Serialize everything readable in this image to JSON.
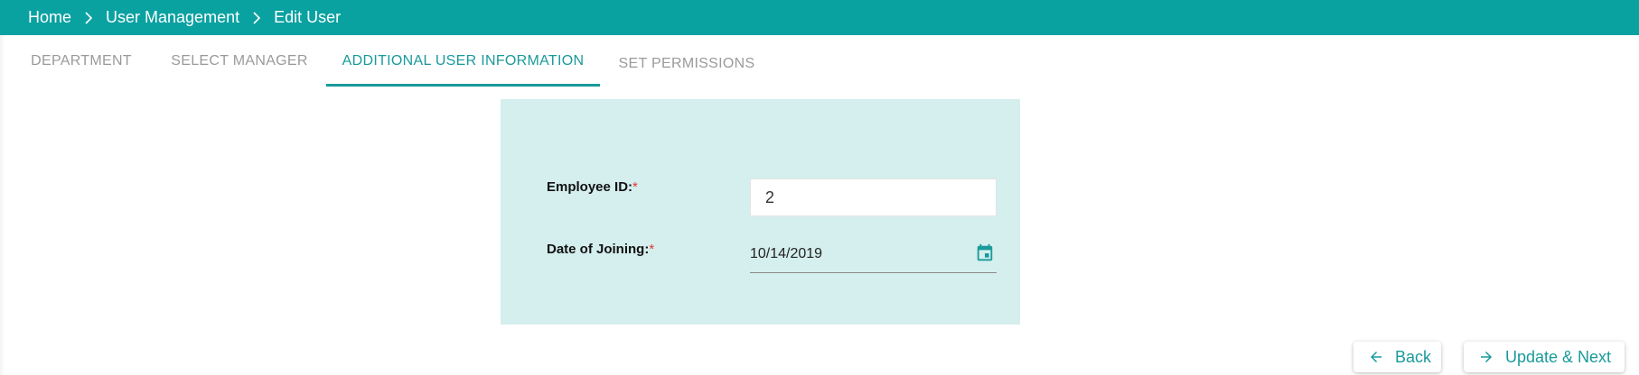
{
  "breadcrumb": {
    "items": [
      "Home",
      "User Management"
    ],
    "current": "Edit User"
  },
  "tabs": [
    {
      "label": "DEPARTMENT",
      "active": false
    },
    {
      "label": "SELECT MANAGER",
      "active": false
    },
    {
      "label": "ADDITIONAL USER INFORMATION",
      "active": true
    },
    {
      "label": "SET PERMISSIONS",
      "active": false
    }
  ],
  "form": {
    "employee_id": {
      "label": "Employee ID:",
      "required_mark": "*",
      "value": "2"
    },
    "date_of_joining": {
      "label": "Date of Joining:",
      "required_mark": "*",
      "value": "10/14/2019"
    }
  },
  "actions": {
    "back_label": "Back",
    "next_label": "Update & Next"
  },
  "colors": {
    "accent": "#0aa1a1",
    "panel_bg": "#d5eeee",
    "required": "#e53935",
    "inactive_tab": "#9a9a9a"
  },
  "icons": {
    "breadcrumb_separator": "chevron-right-icon",
    "date_picker": "calendar-icon",
    "back": "arrow-left-icon",
    "next": "arrow-right-icon"
  }
}
